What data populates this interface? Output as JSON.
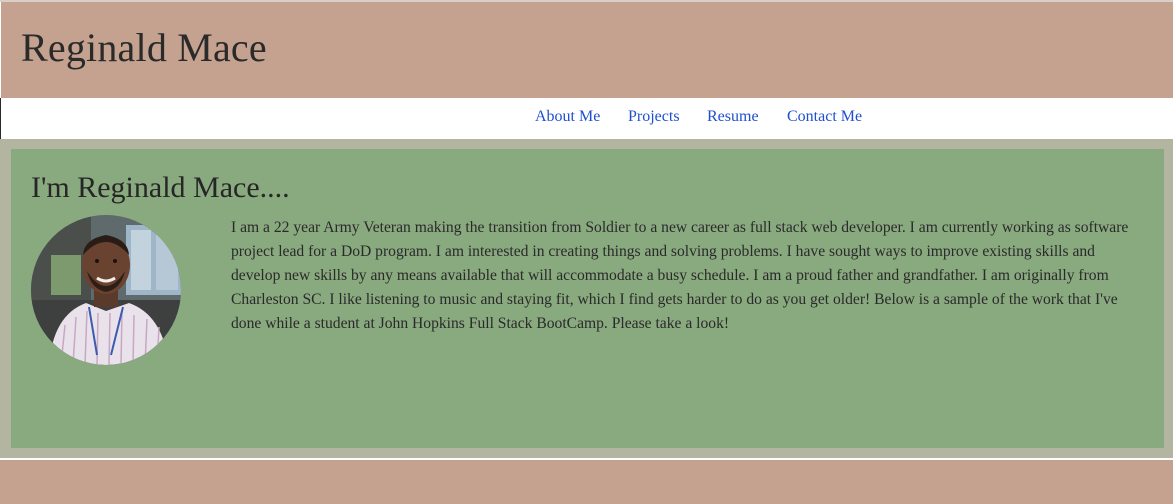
{
  "header": {
    "title": "Reginald Mace"
  },
  "nav": {
    "items": [
      "About Me",
      "Projects",
      "Resume",
      "Contact Me"
    ]
  },
  "about": {
    "heading": "I'm Reginald Mace....",
    "bio": "I am a 22 year Army Veteran making the transition from Soldier to a new career as full stack web developer. I am currently working as software project lead for a DoD program. I am interested in creating things and solving problems. I have sought ways to improve existing skills and develop new skills by any means available that will accommodate a busy schedule. I am a proud father and grandfather. I am originally from Charleston SC. I like listening to music and staying fit, which I find gets harder to do as you get older! Below is a sample of the work that I've done while a student at John Hopkins Full Stack BootCamp. Please take a look!"
  },
  "colors": {
    "header_bg": "#c5a28f",
    "panel_bg": "#89a97f",
    "panel_border": "#b4b5a1",
    "link": "#1f4fd1"
  }
}
